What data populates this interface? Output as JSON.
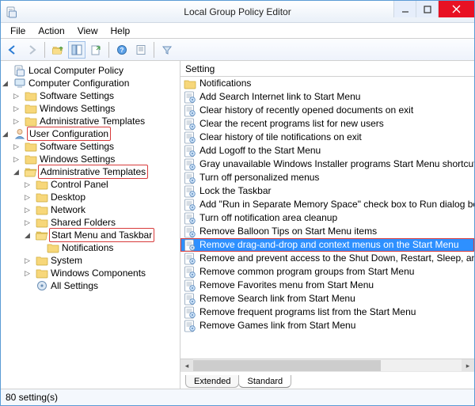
{
  "title": "Local Group Policy Editor",
  "menu": [
    "File",
    "Action",
    "View",
    "Help"
  ],
  "column_header": "Setting",
  "tree": {
    "root": "Local Computer Policy",
    "cc": {
      "label": "Computer Configuration",
      "children": [
        "Software Settings",
        "Windows Settings",
        "Administrative Templates"
      ]
    },
    "uc": {
      "label": "User Configuration",
      "children": [
        "Software Settings",
        "Windows Settings"
      ],
      "admin": {
        "label": "Administrative Templates",
        "children_before": [
          "Control Panel",
          "Desktop",
          "Network",
          "Shared Folders"
        ],
        "smt": {
          "label": "Start Menu and Taskbar",
          "children": [
            "Notifications"
          ]
        },
        "children_after": [
          "System",
          "Windows Components",
          "All Settings"
        ]
      }
    }
  },
  "settings": [
    "Notifications",
    "Add Search Internet link to Start Menu",
    "Clear history of recently opened documents on exit",
    "Clear the recent programs list for new users",
    "Clear history of tile notifications on exit",
    "Add Logoff to the Start Menu",
    "Gray unavailable Windows Installer programs Start Menu shortcuts",
    "Turn off personalized menus",
    "Lock the Taskbar",
    "Add \"Run in Separate Memory Space\" check box to Run dialog box",
    "Turn off notification area cleanup",
    "Remove Balloon Tips on Start Menu items",
    "Remove drag-and-drop and context menus on the Start Menu",
    "Remove and prevent access to the Shut Down, Restart, Sleep, and Hibernate commands",
    "Remove common program groups from Start Menu",
    "Remove Favorites menu from Start Menu",
    "Remove Search link from Start Menu",
    "Remove frequent programs list from the Start Menu",
    "Remove Games link from Start Menu"
  ],
  "selected_index": 12,
  "tabs": {
    "left": "Extended",
    "right": "Standard"
  },
  "status": "80 setting(s)"
}
